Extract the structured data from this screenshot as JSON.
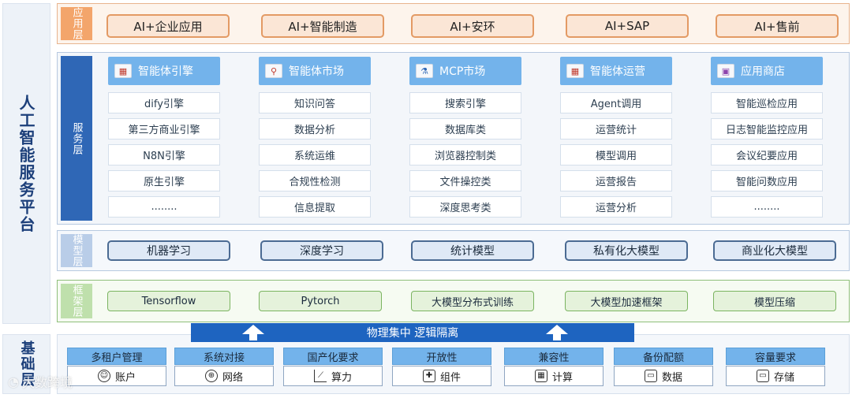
{
  "left_band": {
    "label": "人工智能服务平台"
  },
  "bottom_band": {
    "label": "基础层"
  },
  "app_layer": {
    "tag": "应用层",
    "items": [
      "AI+企业应用",
      "AI+智能制造",
      "AI+安环",
      "AI+SAP",
      "AI+售前"
    ]
  },
  "service_layer": {
    "tag": "服务层",
    "columns": [
      {
        "title": "智能体引擎",
        "icon": "chart-image-icon",
        "items": [
          "dify引擎",
          "第三方商业引擎",
          "N8N引擎",
          "原生引擎",
          "........"
        ]
      },
      {
        "title": "智能体市场",
        "icon": "market-search-icon",
        "items": [
          "知识问答",
          "数据分析",
          "系统运维",
          "合规性检测",
          "信息提取"
        ]
      },
      {
        "title": "MCP市场",
        "icon": "mcp-bottles-icon",
        "items": [
          "搜索引擎",
          "数据库类",
          "浏览器控制类",
          "文件操控类",
          "深度思考类"
        ]
      },
      {
        "title": "智能体运营",
        "icon": "operations-chart-icon",
        "items": [
          "Agent调用",
          "运营统计",
          "模型调用",
          "运营报告",
          "运营分析"
        ]
      },
      {
        "title": "应用商店",
        "icon": "app-store-icon",
        "items": [
          "智能巡检应用",
          "日志智能监控应用",
          "会议纪要应用",
          "智能问数应用",
          "........"
        ]
      }
    ]
  },
  "model_layer": {
    "tag": "模型层",
    "items": [
      "机器学习",
      "深度学习",
      "统计模型",
      "私有化大模型",
      "商业化大模型"
    ]
  },
  "framework_layer": {
    "tag": "框架层",
    "items": [
      "Tensorflow",
      "Pytorch",
      "大模型分布式训练",
      "大模型加速框架",
      "模型压缩"
    ]
  },
  "banner": {
    "text": "物理集中 逻辑隔离"
  },
  "base_layer": {
    "items": [
      {
        "title": "多租户管理",
        "sub": "账户",
        "icon": "user-icon"
      },
      {
        "title": "系统对接",
        "sub": "网络",
        "icon": "globe-icon"
      },
      {
        "title": "国产化要求",
        "sub": "算力",
        "icon": "line-chart-icon"
      },
      {
        "title": "开放性",
        "sub": "组件",
        "icon": "puzzle-icon"
      },
      {
        "title": "兼容性",
        "sub": "计算",
        "icon": "grid-icon"
      },
      {
        "title": "备份配额",
        "sub": "数据",
        "icon": "save-icon"
      },
      {
        "title": "容量要求",
        "sub": "存储",
        "icon": "save-icon"
      }
    ]
  },
  "watermark": {
    "text": "大数跨境"
  }
}
